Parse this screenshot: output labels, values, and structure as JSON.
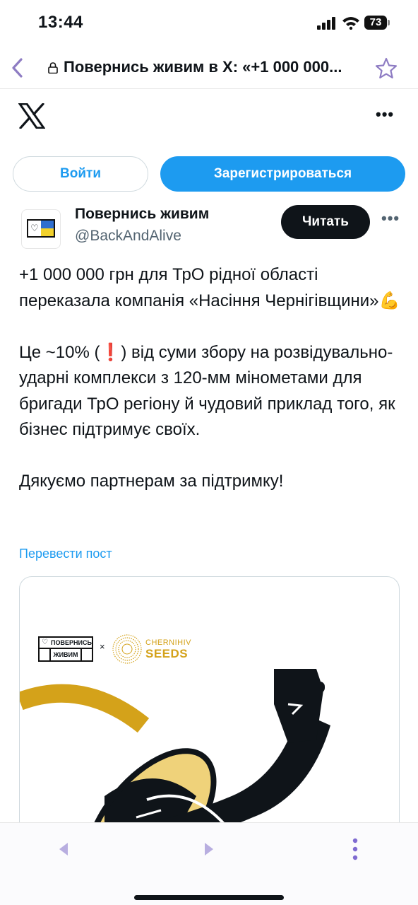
{
  "status_bar": {
    "time": "13:44",
    "battery": "73"
  },
  "browser": {
    "tab_title": "Повернись живим в X: «+1 000 000...",
    "accent_color": "#8e7cc3"
  },
  "header": {
    "logo": "x-logo-icon",
    "more": "•••"
  },
  "auth": {
    "login_label": "Войти",
    "signup_label": "Зарегистрироваться"
  },
  "tweet": {
    "author_name": "Повернись живим",
    "author_handle": "@BackAndAlive",
    "follow_label": "Читать",
    "more": "•••",
    "paragraphs": [
      "+1 000 000 грн для ТрО рідної області переказала компанія «Насіння Чернігівщини»💪",
      "Це ~10% (❗️) від суми збору на розвідувально-ударні комплекси з 120-мм мінометами для бригади ТрО регіону й чудовий приклад того, як бізнес підтримує своїх.",
      "Дякуємо партнерам за підтримку!"
    ],
    "translate_label": "Перевести пост"
  },
  "media": {
    "brand_line1": "ПОВЕРНИСЬ",
    "brand_line2": "ЖИВИМ",
    "brand_x": "×",
    "partner_small": "CHERNIHIV",
    "partner_big": "SEEDS",
    "gold_color": "#d4a21a",
    "light_gold_color": "#efd27a"
  },
  "colors": {
    "primary_blue": "#1d9bf0",
    "text_dark": "#0f1419",
    "text_gray": "#536471"
  }
}
